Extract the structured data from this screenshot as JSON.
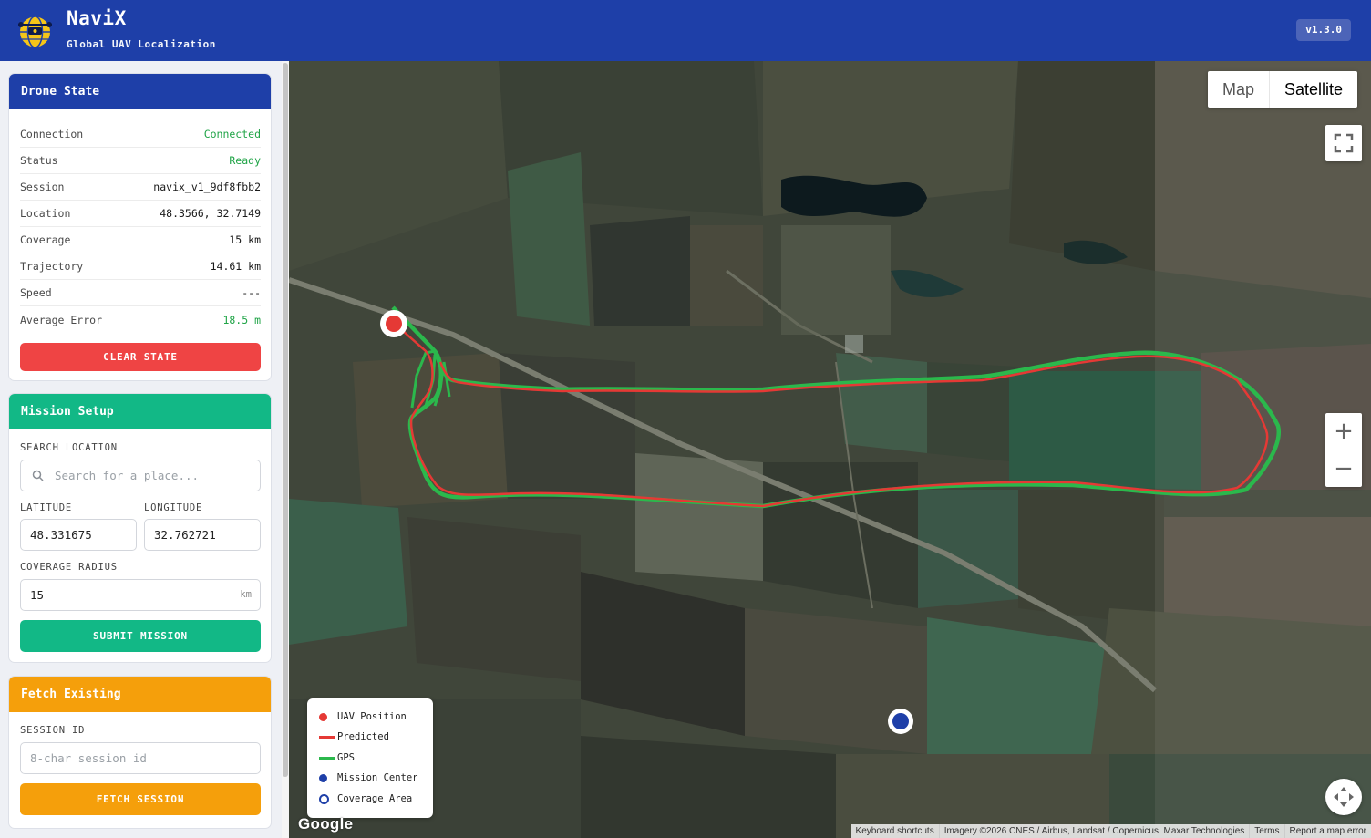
{
  "header": {
    "title": "NaviX",
    "subtitle": "Global UAV Localization",
    "version": "v1.3.0"
  },
  "drone_state": {
    "title": "Drone State",
    "rows": [
      {
        "label": "Connection",
        "value": "Connected"
      },
      {
        "label": "Status",
        "value": "Ready"
      },
      {
        "label": "Session",
        "value": "navix_v1_9df8fbb2"
      },
      {
        "label": "Location",
        "value": "48.3566, 32.7149"
      },
      {
        "label": "Coverage",
        "value": "15 km"
      },
      {
        "label": "Trajectory",
        "value": "14.61 km"
      },
      {
        "label": "Speed",
        "value": "---"
      },
      {
        "label": "Average Error",
        "value": "18.5 m"
      }
    ],
    "clear_label": "CLEAR STATE"
  },
  "mission": {
    "title": "Mission Setup",
    "search_label": "SEARCH LOCATION",
    "search_placeholder": "Search for a place...",
    "latitude_label": "LATITUDE",
    "latitude_value": "48.331675",
    "longitude_label": "LONGITUDE",
    "longitude_value": "32.762721",
    "radius_label": "COVERAGE RADIUS",
    "radius_value": "15",
    "radius_unit": "km",
    "submit_label": "SUBMIT MISSION"
  },
  "fetch": {
    "title": "Fetch Existing",
    "session_label": "SESSION ID",
    "session_placeholder": "8-char session id",
    "fetch_label": "FETCH SESSION"
  },
  "map": {
    "type_map": "Map",
    "type_satellite": "Satellite",
    "zoom_in": "+",
    "zoom_out": "−",
    "google_logo": "Google",
    "attribution": [
      "Keyboard shortcuts",
      "Imagery ©2026 CNES / Airbus, Landsat / Copernicus, Maxar Technologies",
      "Terms",
      "Report a map error"
    ],
    "legend": [
      {
        "label": "UAV Position",
        "icon": "red-dot"
      },
      {
        "label": "Predicted",
        "icon": "red-line"
      },
      {
        "label": "GPS",
        "icon": "green-line"
      },
      {
        "label": "Mission Center",
        "icon": "blue-dot"
      },
      {
        "label": "Coverage Area",
        "icon": "blue-ring"
      }
    ]
  },
  "colors": {
    "header": "#1e3fa8",
    "mission": "#12b886",
    "fetch": "#f59f0b",
    "danger": "#ef4444",
    "success": "#20a447",
    "gps": "#2bb84c",
    "predicted": "#e53935",
    "mission_center": "#1e3fa8"
  }
}
